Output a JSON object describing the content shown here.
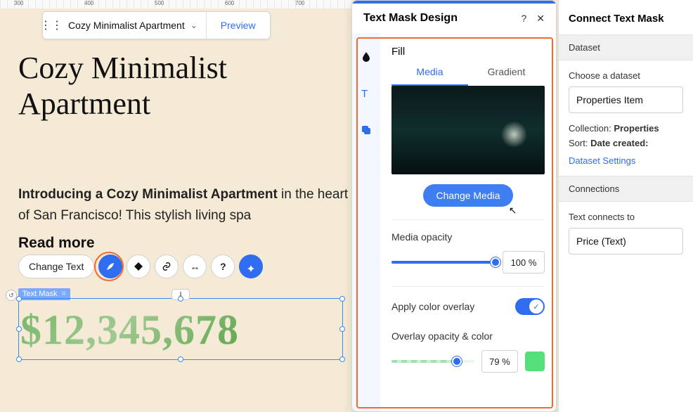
{
  "ruler": {
    "marks": [
      "300",
      "400",
      "500",
      "600",
      "700"
    ]
  },
  "page_toolbar": {
    "page_name": "Cozy Minimalist Apartment",
    "preview_label": "Preview"
  },
  "canvas": {
    "heading": "Cozy Minimalist Apartment",
    "intro_bold": "Introducing a Cozy Minimalist Apartment",
    "intro_rest": " in the heart of San Francisco! This stylish living spa",
    "readmore": "Read more",
    "element_toolbar": {
      "change_text": "Change Text"
    },
    "selection_tag": "Text Mask",
    "price": "$12,345,678"
  },
  "design_panel": {
    "title": "Text Mask Design",
    "section_title": "Fill",
    "tabs": {
      "media": "Media",
      "gradient": "Gradient"
    },
    "change_media": "Change Media",
    "media_opacity_label": "Media opacity",
    "media_opacity_value": "100 %",
    "media_opacity_pct": 100,
    "apply_overlay_label": "Apply color overlay",
    "apply_overlay_on": true,
    "overlay_label": "Overlay opacity & color",
    "overlay_value": "79 %",
    "overlay_pct": 79,
    "overlay_color": "#55e07a"
  },
  "sidebar": {
    "title": "Connect Text Mask",
    "dataset_hdr": "Dataset",
    "choose_label": "Choose a dataset",
    "dataset_value": "Properties Item",
    "collection_label": "Collection:",
    "collection_value": "Properties",
    "sort_label": "Sort:",
    "sort_value": "Date created:",
    "settings_link": "Dataset Settings",
    "connections_hdr": "Connections",
    "connects_label": "Text connects to",
    "connects_value": "Price (Text)"
  }
}
